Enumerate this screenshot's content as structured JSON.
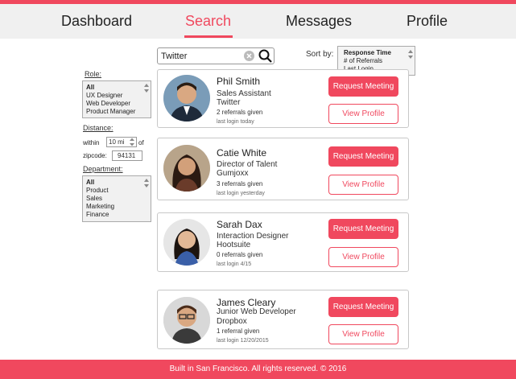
{
  "nav": {
    "items": [
      {
        "label": "Dashboard"
      },
      {
        "label": "Search"
      },
      {
        "label": "Messages"
      },
      {
        "label": "Profile"
      }
    ],
    "active": "Search"
  },
  "search": {
    "value": "Twitter"
  },
  "sort": {
    "label": "Sort by:",
    "options": [
      "Response Time",
      "# of Referrals",
      "Last Login"
    ],
    "selected": "Response Time"
  },
  "filters": {
    "role_label": "Role:",
    "role_options": [
      "All",
      "UX Designer",
      "Web Developer",
      "Product Manager"
    ],
    "role_selected": "All",
    "distance_label": "Distance:",
    "within_label": "within",
    "within_value": "10 mi",
    "of_label": "of",
    "zipcode_label": "zipcode:",
    "zipcode_value": "94131",
    "department_label": "Department:",
    "department_options": [
      "All",
      "Product",
      "Sales",
      "Marketing",
      "Finance"
    ],
    "department_selected": "All"
  },
  "results": [
    {
      "name": "Phil Smith",
      "title": "Sales Assistant",
      "company": "Twitter",
      "referrals": "2 referrals given",
      "last_login": "last login today",
      "request_label": "Request Meeting",
      "profile_label": "View Profile"
    },
    {
      "name": "Catie White",
      "title": "Director of Talent",
      "company": "Gumjoxx",
      "referrals": "3 referrals given",
      "last_login": "last login yesterday",
      "request_label": "Request Meeting",
      "profile_label": "View Profile"
    },
    {
      "name": "Sarah Dax",
      "title": "Interaction Designer",
      "company": "Hootsuite",
      "referrals": "0 referrals given",
      "last_login": "last login 4/15",
      "request_label": "Request Meeting",
      "profile_label": "View Profile"
    },
    {
      "name": "James Cleary",
      "title": "Junior Web Developer",
      "company": "Dropbox",
      "referrals": "1 referral given",
      "last_login": "last login 12/20/2015",
      "request_label": "Request Meeting",
      "profile_label": "View Profile"
    }
  ],
  "footer": {
    "text": "Built in San Francisco. All rights reserved. © 2016"
  },
  "colors": {
    "accent": "#f0485e",
    "nav_bg": "#f0f0f0"
  }
}
